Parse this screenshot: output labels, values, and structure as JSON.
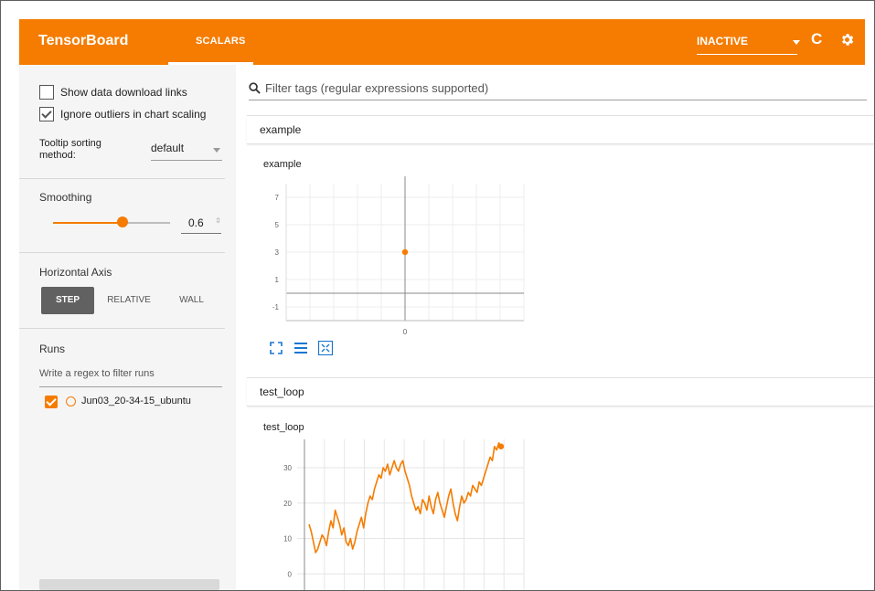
{
  "header": {
    "app_name": "TensorBoard",
    "tab_label": "SCALARS",
    "status_value": "INACTIVE",
    "accent_color": "#f57c00"
  },
  "sidebar": {
    "show_download_label": "Show data download links",
    "ignore_outliers_label": "Ignore outliers in chart scaling",
    "show_download_checked": false,
    "ignore_outliers_checked": true,
    "tooltip_label": "Tooltip sorting method:",
    "tooltip_value": "default",
    "smoothing_title": "Smoothing",
    "smoothing_value": "0.6",
    "smoothing_level": 0.6,
    "horizontal_axis_title": "Horizontal Axis",
    "axis_options": [
      "STEP",
      "RELATIVE",
      "WALL"
    ],
    "axis_selected": "STEP",
    "runs_title": "Runs",
    "runs_filter_placeholder": "Write a regex to filter runs",
    "runs": [
      {
        "name": "Jun03_20-34-15_ubuntu",
        "checked": true,
        "color": "#f57c00"
      }
    ]
  },
  "main": {
    "filter_placeholder": "Filter tags (regular expressions supported)",
    "categories": [
      {
        "name": "example",
        "card_title": "example"
      },
      {
        "name": "test_loop",
        "card_title": "test_loop"
      }
    ]
  },
  "chart_data": [
    {
      "type": "scatter",
      "title": "example",
      "x": [
        0
      ],
      "y": [
        3
      ],
      "yticks": [
        -1,
        1,
        3,
        5,
        7
      ],
      "xticks": [
        0
      ],
      "ylim": [
        -2,
        8
      ],
      "grid": true
    },
    {
      "type": "line",
      "title": "test_loop",
      "yticks": [
        0,
        10,
        20,
        30
      ],
      "ylim": [
        -2,
        38
      ],
      "grid": true,
      "y": [
        14,
        12,
        9,
        6,
        7,
        9,
        11,
        10,
        8,
        12,
        15,
        13,
        18,
        16,
        14,
        11,
        13,
        9,
        8,
        10,
        7,
        9,
        12,
        14,
        16,
        13,
        17,
        20,
        22,
        21,
        24,
        26,
        28,
        27,
        30,
        29,
        31,
        28,
        30,
        32,
        30,
        29,
        31,
        32,
        29,
        27,
        25,
        22,
        20,
        18,
        19,
        17,
        21,
        20,
        18,
        22,
        19,
        17,
        21,
        23,
        20,
        18,
        16,
        19,
        22,
        24,
        20,
        17,
        15,
        19,
        22,
        20,
        21,
        23,
        22,
        25,
        24,
        23,
        26,
        25,
        27,
        29,
        31,
        33,
        32,
        36,
        35,
        37,
        36
      ]
    }
  ]
}
